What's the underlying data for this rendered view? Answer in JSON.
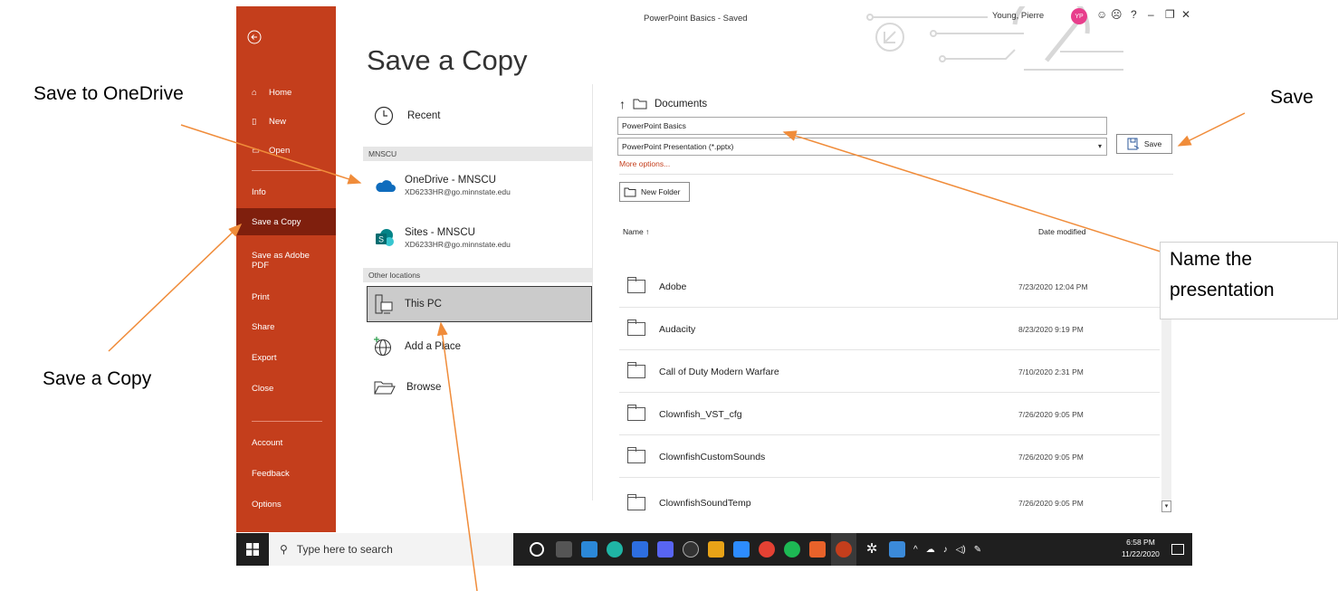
{
  "annotations": {
    "save_to_onedrive": "Save to OneDrive",
    "save_a_copy": "Save a Copy",
    "save": "Save",
    "name_the": "Name the",
    "presentation": "presentation"
  },
  "window": {
    "title": "PowerPoint Basics  -  Saved",
    "user": "Young, Pierre",
    "avatar_initials": "YP",
    "controls": [
      "☺",
      "☹",
      "?",
      "–",
      "❐",
      "✕"
    ]
  },
  "nav": {
    "back_icon": "back-arrow-icon",
    "items": [
      {
        "label": "Home",
        "icon": "home-icon"
      },
      {
        "label": "New",
        "icon": "new-doc-icon"
      },
      {
        "label": "Open",
        "icon": "open-folder-icon"
      },
      {
        "label": "Info"
      },
      {
        "label": "Save a Copy"
      },
      {
        "label": "Save as Adobe PDF"
      },
      {
        "label": "Print"
      },
      {
        "label": "Share"
      },
      {
        "label": "Export"
      },
      {
        "label": "Close"
      },
      {
        "label": "Account"
      },
      {
        "label": "Feedback"
      },
      {
        "label": "Options"
      }
    ]
  },
  "heading": "Save a Copy",
  "locations": {
    "recent": "Recent",
    "section_mnscu": "MNSCU",
    "onedrive_title": "OneDrive - MNSCU",
    "onedrive_sub": "XD6233HR@go.minnstate.edu",
    "sites_title": "Sites - MNSCU",
    "sites_sub": "XD6233HR@go.minnstate.edu",
    "section_other": "Other locations",
    "this_pc": "This PC",
    "add_place": "Add a Place",
    "browse": "Browse"
  },
  "save_pane": {
    "path": "Documents",
    "filename": "PowerPoint Basics",
    "filetype": "PowerPoint Presentation (*.pptx)",
    "save_label": "Save",
    "more_options": "More options...",
    "new_folder": "New Folder",
    "col_name": "Name ↑",
    "col_date": "Date modified"
  },
  "files": [
    {
      "name": "Adobe",
      "date": "7/23/2020 12:04 PM"
    },
    {
      "name": "Audacity",
      "date": "8/23/2020 9:19 PM"
    },
    {
      "name": "Call of Duty Modern Warfare",
      "date": "7/10/2020 2:31 PM"
    },
    {
      "name": "Clownfish_VST_cfg",
      "date": "7/26/2020 9:05 PM"
    },
    {
      "name": "ClownfishCustomSounds",
      "date": "7/26/2020 9:05 PM"
    },
    {
      "name": "ClownfishSoundTemp",
      "date": "7/26/2020 9:05 PM"
    }
  ],
  "taskbar": {
    "search_placeholder": "Type here to search",
    "time": "6:58 PM",
    "date": "11/22/2020",
    "colors": {
      "powerpoint_accent": "#c43e1c",
      "powerpoint_nav_active": "#7f1f0d",
      "annotation_arrow": "#f08c3a"
    }
  }
}
